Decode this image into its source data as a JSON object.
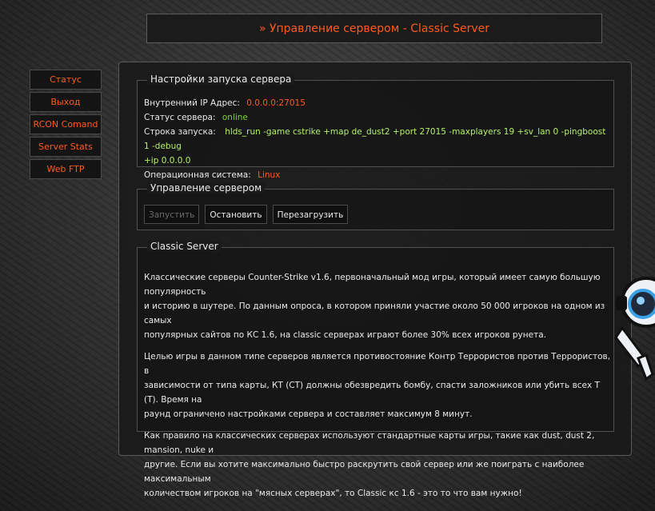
{
  "header": {
    "title": "» Управление сервером - Classic Server"
  },
  "sidebar": {
    "items": [
      {
        "label": "Статус"
      },
      {
        "label": "Выход"
      },
      {
        "label": "RCON Comand"
      },
      {
        "label": "Server Stats"
      },
      {
        "label": "Web FTP"
      }
    ]
  },
  "settings": {
    "title": "Настройки запуска сервера",
    "ip_label": "Внутренний IP Адрес:",
    "ip_value": "0.0.0.0:27015",
    "status_label": "Статус сервера:",
    "status_value": "online",
    "cmd_label": "Строка запуска:",
    "cmd_value": "hlds_run -game cstrike +map de_dust2 +port 27015 -maxplayers 19 +sv_lan 0 -pingboost 1 -debug",
    "cmd_value_cont": "+ip 0.0.0.0",
    "os_label": "Операционная система:",
    "os_value": "Linux"
  },
  "control": {
    "title": "Управление сервером",
    "start_label": "Запустить",
    "stop_label": "Остановить",
    "restart_label": "Перезагрузить"
  },
  "description": {
    "title": "Classic Server",
    "p1_l1": "Классические серверы Counter-Strike v1.6, первоначальный мод игры, который имеет самую большую популярность",
    "p1_l2": "и историю в шутере. По данным опроса, в котором приняли участие около 50 000 игроков на одном из самых",
    "p1_l3": "популярных сайтов по КС 1.6, на classic серверах играют более 30% всех игроков рунета.",
    "p2_l1": "Целью игры в данном типе серверов является противостояние Контр Террористов против Террористов, в",
    "p2_l2": "зависимости от типа карты, КТ (СТ) должны обезвредить бомбу, спасти заложников или убить всех Т (Т). Время на",
    "p2_l3": "раунд ограничено настройками сервера и составляет максимум 8 минут.",
    "p3_l1": "Как правило на классических серверах используют стандартные карты игры, такие как dust, dust 2, mansion, nuke и",
    "p3_l2": "другие. Если вы хотите максимально быстро раскрутить свой сервер или же поиграть с наиболее максимальным",
    "p3_l3": "количеством игроков на \"мясных серверах\", то Classic кс 1.6 - это то что вам нужно!"
  },
  "colors": {
    "accent": "#ff5a1f",
    "online": "#7cd23a",
    "command": "#b4f06a"
  }
}
